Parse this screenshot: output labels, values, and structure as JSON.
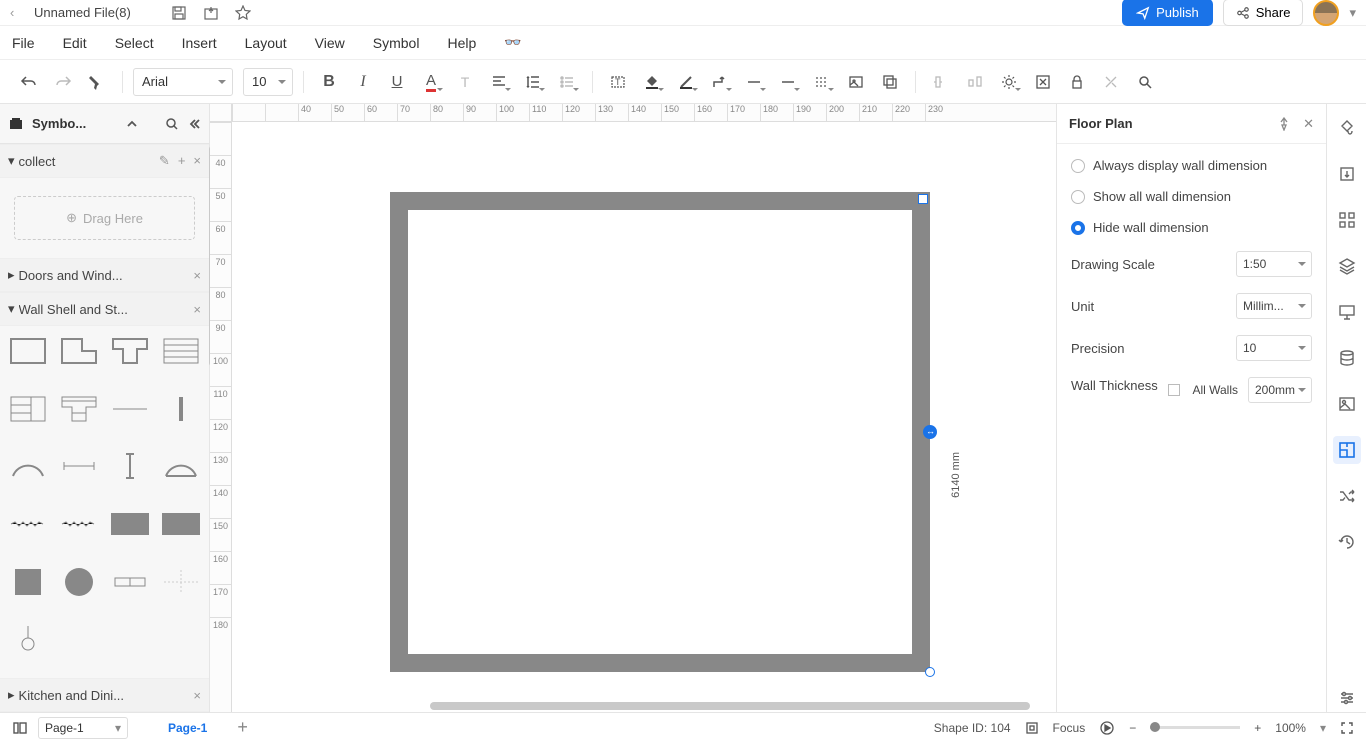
{
  "titlebar": {
    "filename": "Unnamed File(8)"
  },
  "actions": {
    "publish": "Publish",
    "share": "Share"
  },
  "menubar": [
    "File",
    "Edit",
    "Select",
    "Insert",
    "Layout",
    "View",
    "Symbol",
    "Help"
  ],
  "toolbar": {
    "font": "Arial",
    "fontsize": "10"
  },
  "left_panel": {
    "title": "Symbo...",
    "categories": [
      {
        "name": "collect",
        "drag_hint": "Drag Here"
      },
      {
        "name": "Doors and Wind..."
      },
      {
        "name": "Wall Shell and St..."
      },
      {
        "name": "Kitchen and Dini..."
      }
    ]
  },
  "ruler_h": [
    "",
    "",
    "40",
    "50",
    "60",
    "70",
    "80",
    "90",
    "100",
    "110",
    "120",
    "130",
    "140",
    "150",
    "160",
    "170",
    "180",
    "190",
    "200",
    "210",
    "220",
    "230"
  ],
  "ruler_v": [
    "",
    "40",
    "50",
    "60",
    "70",
    "80",
    "90",
    "100",
    "110",
    "120",
    "130",
    "140",
    "150",
    "160",
    "170",
    "180"
  ],
  "canvas": {
    "dimension_label": "6140 mm"
  },
  "right_panel": {
    "title": "Floor Plan",
    "radios": [
      "Always display wall dimension",
      "Show all wall dimension",
      "Hide wall dimension"
    ],
    "radio_active": 2,
    "drawing_scale": {
      "label": "Drawing Scale",
      "value": "1:50"
    },
    "unit": {
      "label": "Unit",
      "value": "Millim..."
    },
    "precision": {
      "label": "Precision",
      "value": "10"
    },
    "wall_thickness": {
      "label": "Wall Thickness",
      "check_label": "All Walls",
      "value": "200mm"
    }
  },
  "statusbar": {
    "page_name": "Page-1",
    "tab": "Page-1",
    "shape_id_lbl": "Shape ID:",
    "shape_id": "104",
    "focus": "Focus",
    "zoom": "100%"
  }
}
